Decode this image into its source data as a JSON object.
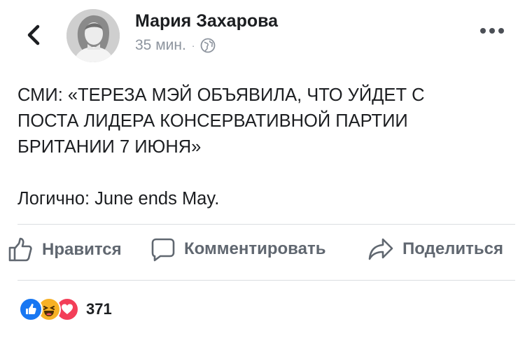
{
  "post": {
    "author": "Мария Захарова",
    "time": "35 мин.",
    "separator": "·",
    "privacy_icon": "globe-icon",
    "text_lines": [
      "СМИ: «ТЕРЕЗА МЭЙ ОБЪЯВИЛА, ЧТО УЙДЕТ С",
      "ПОСТА ЛИДЕРА КОНСЕРВАТИВНОЙ ПАРТИИ",
      "БРИТАНИИ 7 ИЮНЯ»"
    ],
    "comment_line": "Логично: June ends May."
  },
  "actions": {
    "like": "Нравится",
    "comment": "Комментировать",
    "share": "Поделиться"
  },
  "reactions": {
    "icons": [
      "like-icon",
      "haha-icon",
      "love-icon"
    ],
    "count": "371"
  },
  "colors": {
    "like_blue": "#1877f2",
    "love_red": "#f33e58",
    "haha_yellow": "#f7b125",
    "muted": "#606770"
  }
}
